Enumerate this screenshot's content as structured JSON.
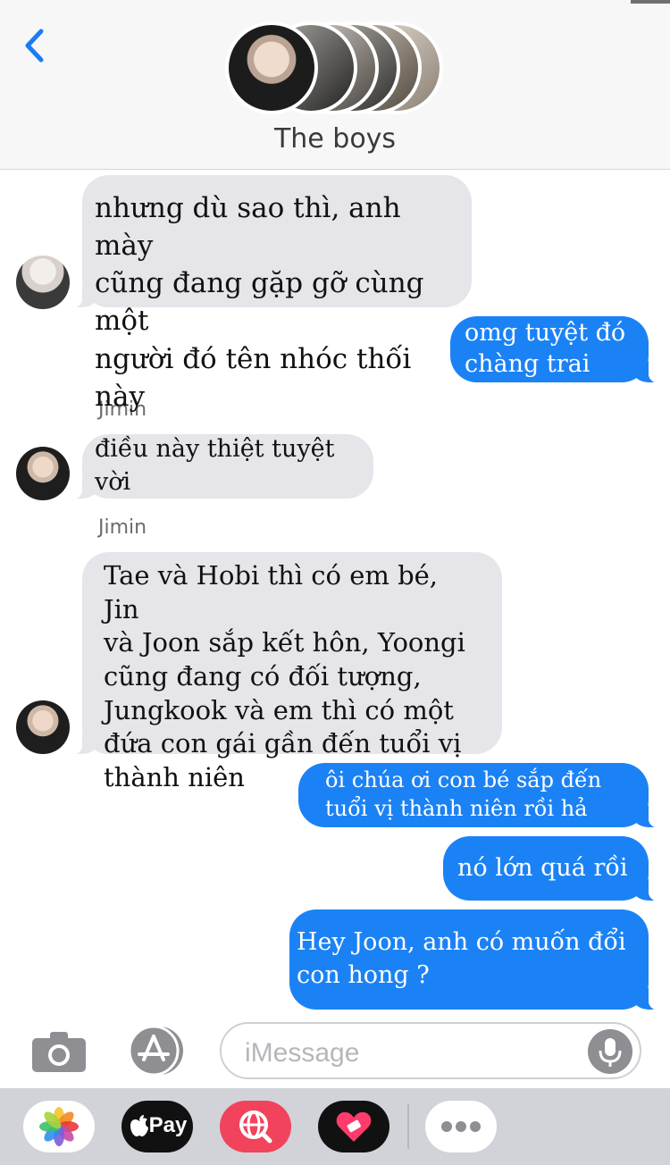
{
  "header": {
    "title": "The boys"
  },
  "messages": {
    "m1": {
      "sender": "",
      "text": "nhưng dù sao thì, anh mày\ncũng đang gặp gỡ cùng một\nngười đó tên nhóc thối này"
    },
    "m2": {
      "text": "omg tuyệt đó\nchàng trai"
    },
    "m3": {
      "sender": "Jimin",
      "text": "điều này thiệt tuyệt vời"
    },
    "m4": {
      "sender": "Jimin",
      "text": "Tae và Hobi thì có em bé, Jin\nvà Joon sắp kết hôn, Yoongi\ncũng đang có đối tượng,\nJungkook và em thì có một\nđứa con gái gần đến tuổi vị\nthành niên"
    },
    "m5": {
      "text": "ôi chúa ơi con bé sắp đến\ntuổi vị thành niên rồi hả"
    },
    "m6": {
      "text": "nó lớn quá rồi"
    },
    "m7": {
      "text": "Hey Joon, anh có muốn đổi\ncon hong ?"
    }
  },
  "input": {
    "placeholder": "iMessage"
  },
  "app_drawer": {
    "apple_pay_label": "Pay"
  },
  "colors": {
    "outgoing_bubble": "#1b82f5",
    "incoming_bubble": "#e5e5ea",
    "accent": "#1b7cf3"
  }
}
